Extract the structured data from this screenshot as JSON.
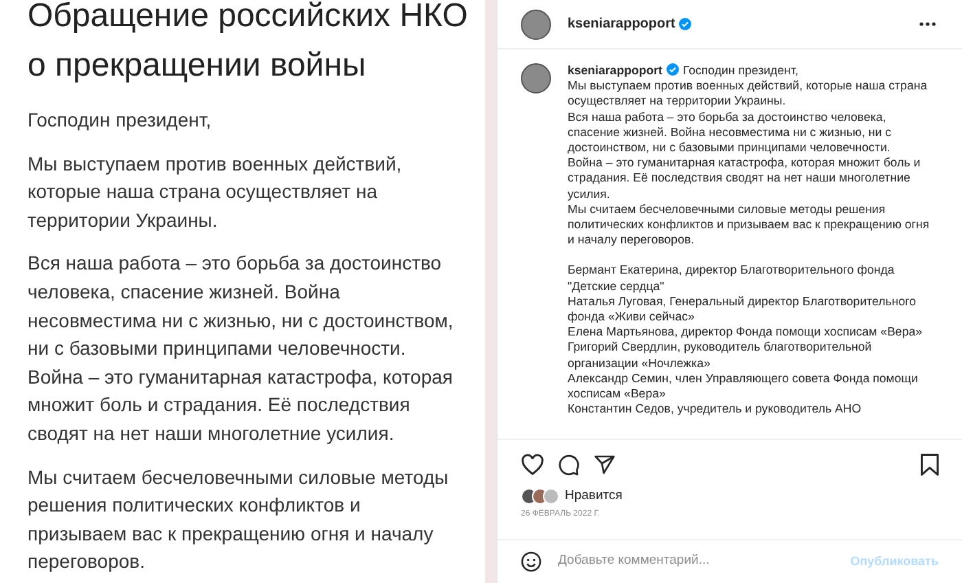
{
  "document": {
    "title": "Обращение российских НКО\nо прекращении войны",
    "paragraphs": [
      "Господин президент,",
      "Мы выступаем против военных действий,\nкоторые наша страна осуществляет на\nтерритории Украины.",
      "Вся наша работа – это борьба за достоинство\nчеловека, спасение жизней. Война\nнесовместима ни с жизнью, ни с достоинством,\nни с базовыми принципами человечности.\nВойна – это гуманитарная катастрофа, которая\nмножит боль и страдания. Её последствия\nсводят на нет наши многолетние усилия.",
      "Мы считаем бесчеловечными силовые методы\nрешения политических конфликтов и\nпризываем вас к прекращению огня и началу\nпереговоров."
    ]
  },
  "post": {
    "username": "kseniarappoport",
    "verified": true,
    "caption": {
      "username": "kseniarappoport",
      "verified": true,
      "lines": [
        "Господин президент,",
        "Мы выступаем против военных действий, которые наша страна осуществляет на территории Украины.",
        "Вся наша работа – это борьба за достоинство человека, спасение жизней. Война несовместима ни с жизнью, ни с достоинством, ни с базовыми принципами человечности.",
        "Война – это гуманитарная катастрофа, которая множит боль и страдания. Её последствия сводят на нет наши многолетние усилия.",
        "Мы считаем бесчеловечными силовые методы решения политических конфликтов и призываем вас к прекращению огня и началу переговоров."
      ],
      "signatories": [
        "Бермант Екатерина, директор Благотворительного фонда \"Детские сердца\"",
        "Наталья Луговая, Генеральный директор Благотворительного фонда «Живи сейчас»",
        "Елена Мартьянова, директор Фонда помощи хосписам «Вера»",
        "Григорий Свердлин, руководитель благотворительной организации «Ночлежка»",
        "Александр Семин, член Управляющего совета Фонда помощи хосписам «Вера»",
        "Константин Седов, учредитель и руководитель АНО"
      ]
    },
    "likes_label": "Нравится",
    "date": "26 ФЕВРАЛЬ 2022 Г.",
    "comment": {
      "placeholder": "Добавьте комментарий...",
      "button": "Опубликовать",
      "button_disabled": true
    }
  }
}
